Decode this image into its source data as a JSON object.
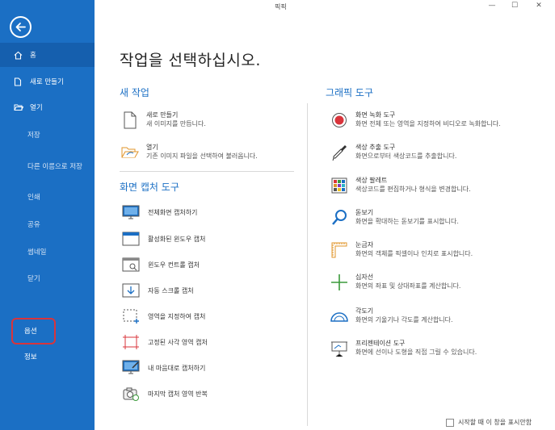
{
  "window": {
    "title": "픽픽",
    "minimize": "—",
    "maximize": "☐",
    "close": "✕"
  },
  "sidebar": {
    "back_icon": "back-arrow-circle-icon",
    "items": [
      {
        "label": "홈",
        "icon": "home-icon",
        "active": true
      },
      {
        "label": "새로 만들기",
        "icon": "new-file-icon"
      },
      {
        "label": "열기",
        "icon": "folder-open-icon"
      },
      {
        "label": "저장"
      },
      {
        "label": "다른 이름으로 저장"
      },
      {
        "label": "인쇄"
      },
      {
        "label": "공유"
      },
      {
        "label": "썸네일"
      },
      {
        "label": "닫기"
      },
      {
        "label": "옵션",
        "highlighted": true
      },
      {
        "label": "정보"
      }
    ]
  },
  "main": {
    "title": "작업을 선택하십시오.",
    "new_task": {
      "title": "새 작업",
      "items": [
        {
          "title": "새로 만들기",
          "desc": "새 이미지를 만듭니다.",
          "icon": "new-document-icon"
        },
        {
          "title": "열기",
          "desc": "기존 이미지 파일을 선택하여 불러옵니다.",
          "icon": "open-folder-icon"
        }
      ]
    },
    "capture": {
      "title": "화면 캡처 도구",
      "items": [
        {
          "label": "전체화면 캡처하기",
          "icon": "fullscreen-capture-icon"
        },
        {
          "label": "활성화된 윈도우 캡처",
          "icon": "active-window-capture-icon"
        },
        {
          "label": "윈도우 컨트롤 캡처",
          "icon": "window-control-capture-icon"
        },
        {
          "label": "자동 스크롤 캡처",
          "icon": "scroll-capture-icon"
        },
        {
          "label": "영역을 지정하여 캡처",
          "icon": "region-capture-icon"
        },
        {
          "label": "고정된 사각 영역 캡처",
          "icon": "fixed-region-capture-icon"
        },
        {
          "label": "내 마음대로 캡처하기",
          "icon": "freehand-capture-icon"
        },
        {
          "label": "마지막 캡처 영역 반복",
          "icon": "repeat-capture-icon"
        }
      ]
    },
    "graphics": {
      "title": "그래픽 도구",
      "items": [
        {
          "title": "화면 녹화 도구",
          "desc": "화면 전체 또는 영역을 지정하여 비디오로 녹화합니다.",
          "icon": "record-icon"
        },
        {
          "title": "색상 추출 도구",
          "desc": "화면으로부터 색상코드를 추출합니다.",
          "icon": "eyedropper-icon"
        },
        {
          "title": "색상 팔레트",
          "desc": "색상코드를 편집하거나 형식을 변경합니다.",
          "icon": "palette-icon"
        },
        {
          "title": "돋보기",
          "desc": "화면을 확대하는 돋보기를 표시합니다.",
          "icon": "magnifier-icon"
        },
        {
          "title": "눈금자",
          "desc": "화면의 객체를 픽셀이나 인치로 표시합니다.",
          "icon": "ruler-icon"
        },
        {
          "title": "십자선",
          "desc": "화면의 좌표 및 상대좌표를 계산합니다.",
          "icon": "crosshair-icon"
        },
        {
          "title": "각도기",
          "desc": "화면의 기울기나 각도를 계산합니다.",
          "icon": "protractor-icon"
        },
        {
          "title": "프리젠테이션 도구",
          "desc": "화면에 선이나 도형을 직접 그릴 수 있습니다.",
          "icon": "presentation-icon"
        }
      ]
    }
  },
  "footer": {
    "dont_show_label": "시작할 때 이 창을 표시안함",
    "checked": false
  },
  "colors": {
    "sidebar": "#1b6fc4",
    "accent": "#1b6fc4",
    "highlight": "#d9343b"
  }
}
